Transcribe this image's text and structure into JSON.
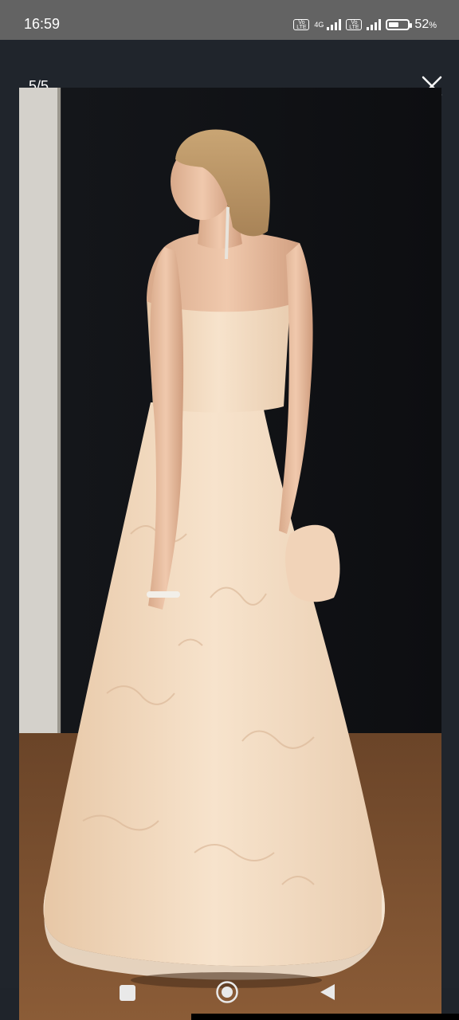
{
  "status_bar": {
    "time": "16:59",
    "volte_label": "Vo LTE",
    "network": "4G",
    "battery_percent": "52",
    "battery_unit": "%"
  },
  "viewer": {
    "counter": "5/5",
    "close_icon": "close-icon"
  },
  "photo": {
    "subject": "woman in strapless blush lace gown with bow, back view",
    "dominant_colors": [
      "#0f1013",
      "#f3dcc2",
      "#8a5a36"
    ]
  },
  "nav_bar": {
    "icons": [
      "recent-apps-icon",
      "home-icon",
      "back-icon"
    ]
  }
}
